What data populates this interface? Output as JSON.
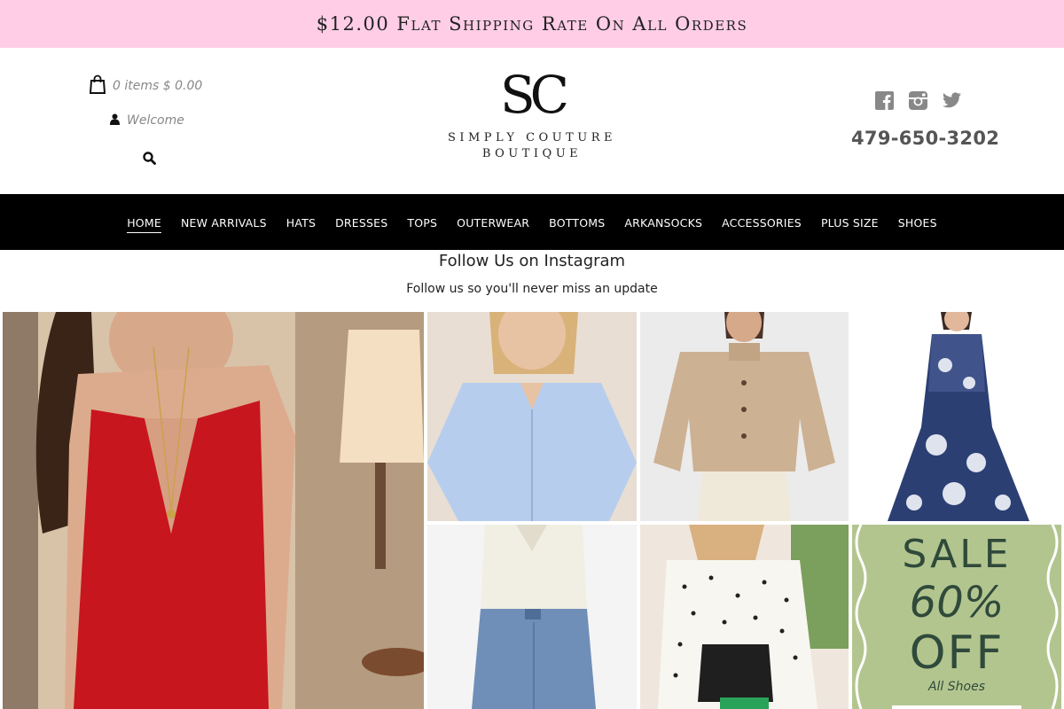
{
  "promo": {
    "text": "$12.00 Flat Shipping Rate On All Orders"
  },
  "header": {
    "cart_text": "0 items $ 0.00",
    "welcome_text": "Welcome",
    "logo": {
      "mark": "SC",
      "line1": "SIMPLY COUTURE",
      "line2": "BOUTIQUE"
    },
    "phone": "479-650-3202",
    "social_icons": [
      "facebook-icon",
      "instagram-icon",
      "twitter-icon"
    ],
    "icons": {
      "cart": "shopping-bag-icon",
      "user": "user-icon",
      "search": "search-icon"
    }
  },
  "nav": {
    "items": [
      "HOME",
      "NEW ARRIVALS",
      "HATS",
      "DRESSES",
      "TOPS",
      "OUTERWEAR",
      "BOTTOMS",
      "ARKANSOCKS",
      "ACCESSORIES",
      "PLUS SIZE",
      "SHOES"
    ],
    "active": "HOME"
  },
  "instagram": {
    "title": "Follow Us on Instagram",
    "subtitle": "Follow us so you'll never miss an update",
    "sale_tile": {
      "line1": "SALE",
      "line2": "60%",
      "line3": "OFF",
      "line4": "All Shoes"
    }
  },
  "colors": {
    "promo_bg": "#ffcde6",
    "nav_bg": "#000000",
    "sale_bg": "#b3c58f",
    "sale_text": "#2f4a3a"
  }
}
